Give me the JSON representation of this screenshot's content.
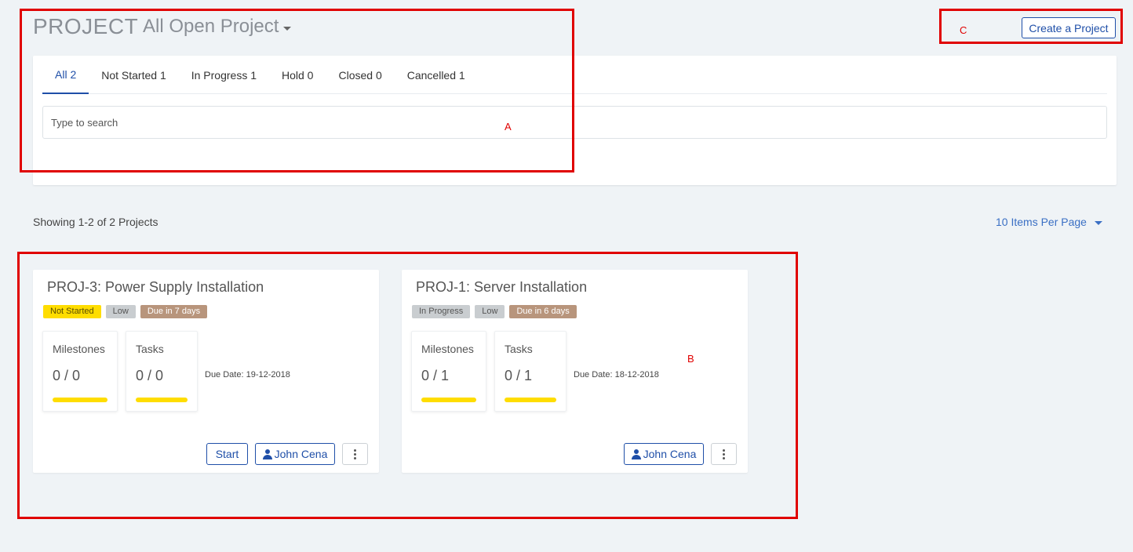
{
  "header": {
    "title": "PROJECT",
    "view_label": "All Open Project",
    "create_label": "Create a Project"
  },
  "tabs": [
    {
      "label": "All 2",
      "active": true
    },
    {
      "label": "Not Started 1",
      "active": false
    },
    {
      "label": "In Progress 1",
      "active": false
    },
    {
      "label": "Hold 0",
      "active": false
    },
    {
      "label": "Closed 0",
      "active": false
    },
    {
      "label": "Cancelled 1",
      "active": false
    }
  ],
  "search": {
    "placeholder": "Type to search",
    "value": ""
  },
  "listing": {
    "showing": "Showing 1-2 of 2 Projects",
    "per_page": "10 Items Per Page"
  },
  "annotations": {
    "a": "A",
    "b": "B",
    "c": "C"
  },
  "projects": [
    {
      "title": "PROJ-3:  Power Supply Installation",
      "status": "Not Started",
      "priority": "Low",
      "due_badge": "Due in 7 days",
      "milestones_label": "Milestones",
      "milestones_value": "0 / 0",
      "tasks_label": "Tasks",
      "tasks_value": "0 / 0",
      "due_date": "Due Date: 19-12-2018",
      "start_label": "Start",
      "owner": "John Cena"
    },
    {
      "title": "PROJ-1:  Server Installation",
      "status": "In Progress",
      "priority": "Low",
      "due_badge": "Due in 6 days",
      "milestones_label": "Milestones",
      "milestones_value": "0 / 1",
      "tasks_label": "Tasks",
      "tasks_value": "0 / 1",
      "due_date": "Due Date: 18-12-2018",
      "owner": "John Cena"
    }
  ],
  "colors": {
    "accent": "#1f4fa8",
    "progress_bar": "#ffdd00",
    "annotation": "#e00000",
    "due_badge": "#b8957c"
  }
}
